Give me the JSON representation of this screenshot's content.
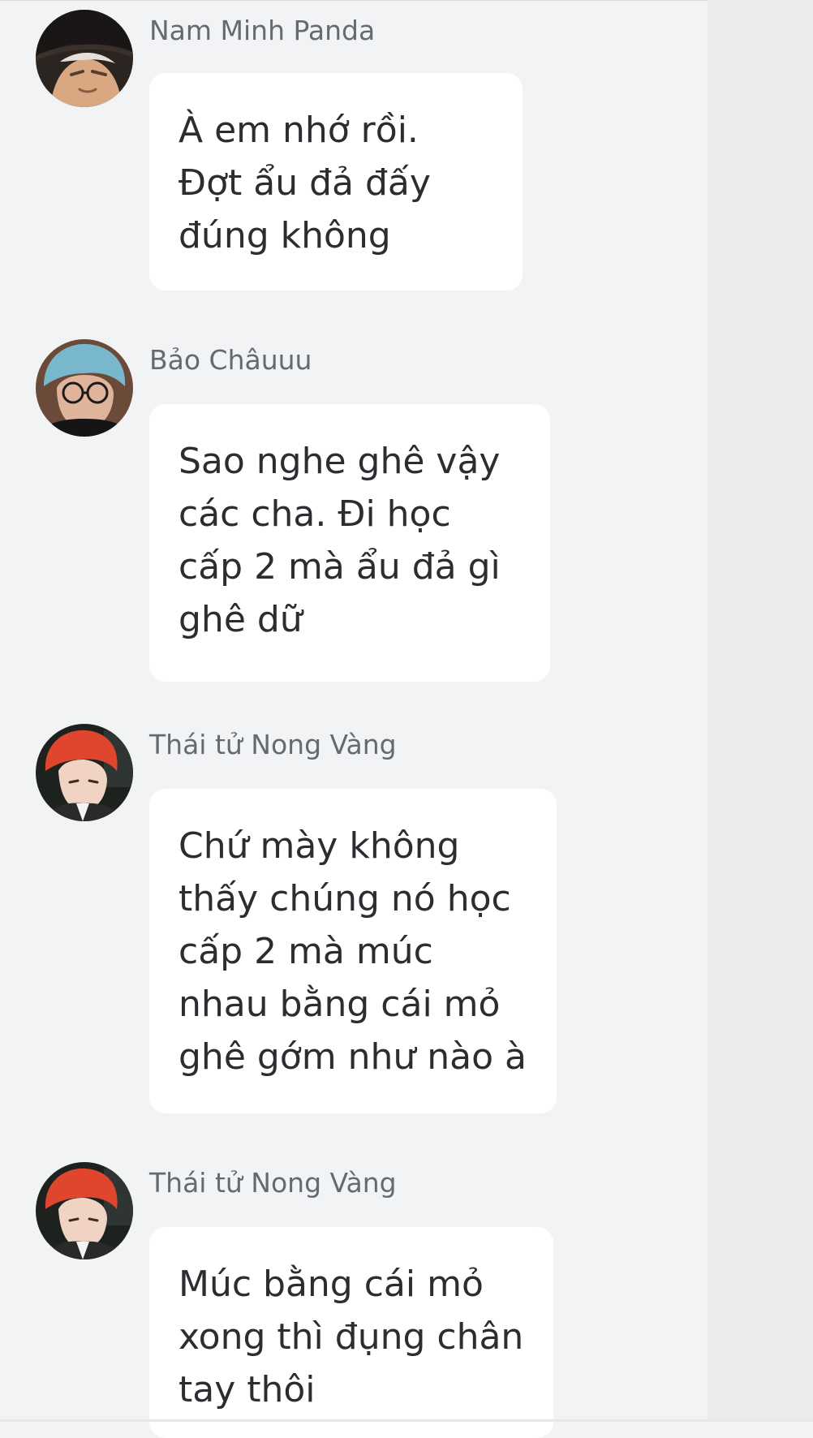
{
  "messages": [
    {
      "sender": "Nam Minh Panda",
      "text": "À em nhớ rồi. Đợt ẩu đả đấy đúng không",
      "avatar_icon": "anime-character-avatar"
    },
    {
      "sender": "Bảo Châuuu",
      "text": "Sao nghe ghê vậy các cha. Đi học cấp 2 mà ẩu đả gì ghê dữ",
      "avatar_icon": "blue-hair-glasses-avatar"
    },
    {
      "sender": "Thái tử Nong Vàng",
      "text": "Chứ mày không thấy chúng nó học cấp 2 mà múc nhau bằng cái mỏ ghê gớm như nào à",
      "avatar_icon": "red-hair-avatar"
    },
    {
      "sender": "Thái tử Nong Vàng",
      "text": "Múc bằng cái mỏ xong thì đụng chân tay thôi",
      "avatar_icon": "red-hair-avatar"
    }
  ],
  "colors": {
    "background": "#f2f3f5",
    "bubble": "#ffffff",
    "sender_text": "#666a70",
    "message_text": "#2b2d31",
    "handle": "#c4c6ca"
  },
  "icons": {
    "drag_handle": "drag-handle-icon"
  }
}
